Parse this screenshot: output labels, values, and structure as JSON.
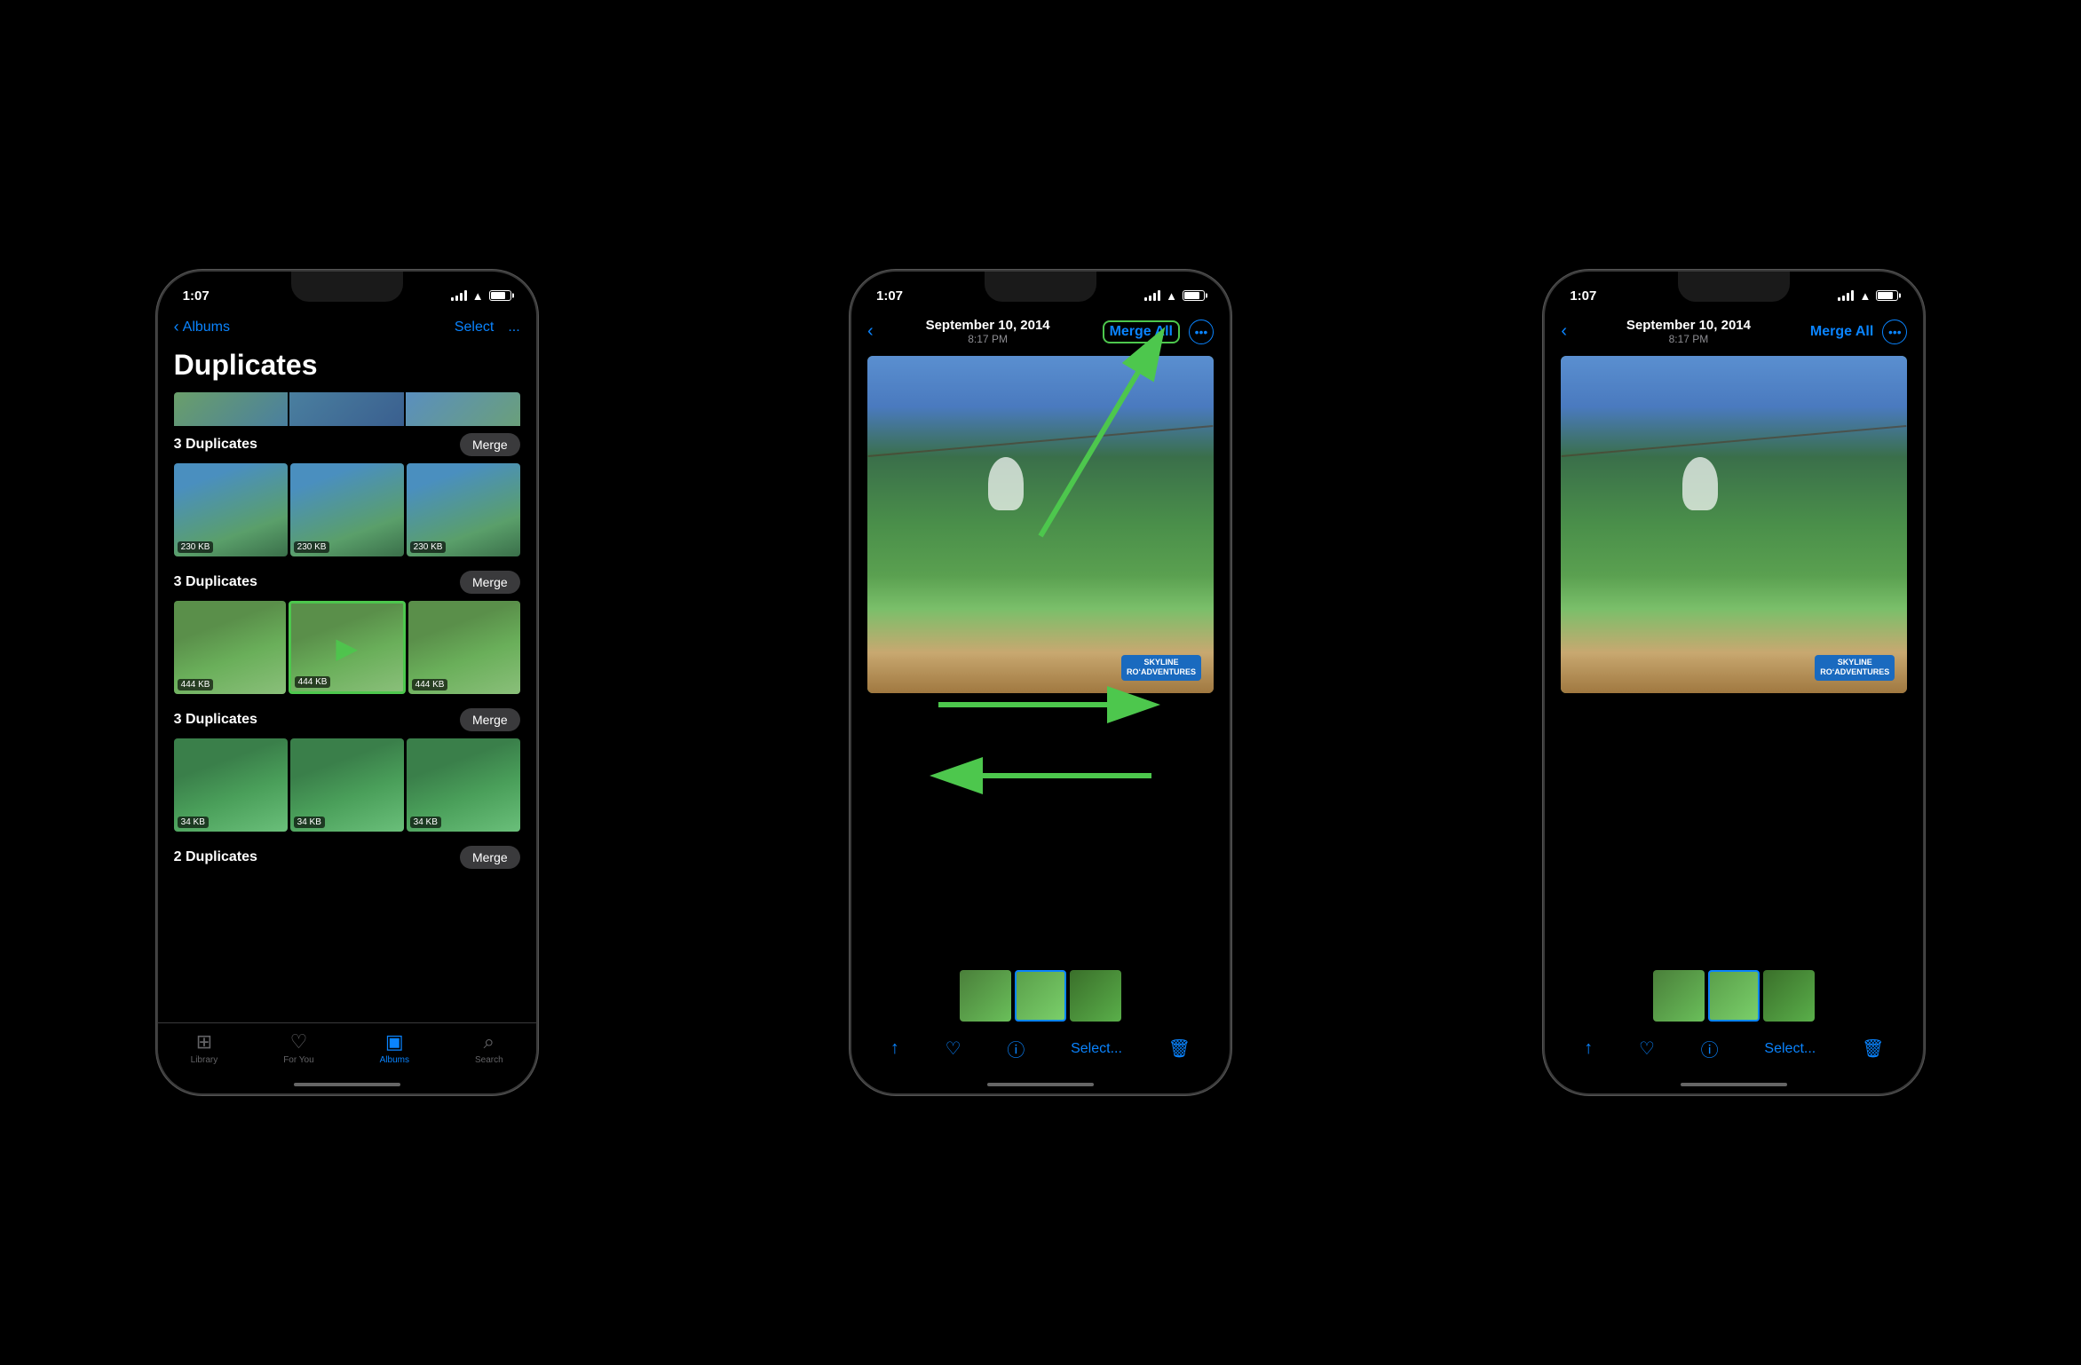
{
  "phone1": {
    "statusBar": {
      "time": "1:07",
      "signal": true,
      "wifi": true,
      "battery": true
    },
    "navBar": {
      "backLabel": "Albums",
      "selectLabel": "Select",
      "moreLabel": "..."
    },
    "title": "Duplicates",
    "groups": [
      {
        "id": "group0",
        "label": "3 Duplicates",
        "mergeLabel": "Merge",
        "photos": [
          {
            "size": "230 KB",
            "bgClass": "bg-group1"
          },
          {
            "size": "230 KB",
            "bgClass": "bg-group1"
          },
          {
            "size": "230 KB",
            "bgClass": "bg-group1"
          }
        ]
      },
      {
        "id": "group1",
        "label": "3 Duplicates",
        "mergeLabel": "Merge",
        "highlighted": true,
        "photos": [
          {
            "size": "444 KB",
            "bgClass": "bg-group2"
          },
          {
            "size": "444 KB",
            "bgClass": "bg-group2",
            "highlighted": true
          },
          {
            "size": "444 KB",
            "bgClass": "bg-group2"
          }
        ]
      },
      {
        "id": "group2",
        "label": "3 Duplicates",
        "mergeLabel": "Merge",
        "photos": [
          {
            "size": "34 KB",
            "bgClass": "bg-group3"
          },
          {
            "size": "34 KB",
            "bgClass": "bg-group3"
          },
          {
            "size": "34 KB",
            "bgClass": "bg-group3"
          }
        ]
      },
      {
        "id": "group3",
        "label": "2 Duplicates",
        "mergeLabel": "Merge",
        "photos": []
      }
    ],
    "tabBar": {
      "items": [
        {
          "label": "Library",
          "icon": "⊞",
          "active": false
        },
        {
          "label": "For You",
          "icon": "♡",
          "active": false
        },
        {
          "label": "Albums",
          "icon": "▣",
          "active": true
        },
        {
          "label": "Search",
          "icon": "⌕",
          "active": false
        }
      ]
    }
  },
  "phone2": {
    "statusBar": {
      "time": "1:07"
    },
    "navBar": {
      "backIcon": "<",
      "date": "September 10, 2014",
      "time": "8:17 PM",
      "mergeAllLabel": "Merge All",
      "mergeAllHighlighted": true,
      "moreIcon": "..."
    },
    "mainPhoto": {
      "skylineBadge": "SKYLINE\nROADVENTURES"
    },
    "thumbnails": [
      {
        "bgClass": "bg-group2"
      },
      {
        "bgClass": "bg-group2"
      },
      {
        "bgClass": "bg-group2"
      }
    ],
    "toolbar": {
      "shareIcon": "↑",
      "heartIcon": "♡",
      "infoIcon": "ⓘ",
      "selectLabel": "Select...",
      "trashIcon": "🗑"
    },
    "arrows": {
      "upArrow": true,
      "rightArrow": true,
      "leftArrow": true
    }
  },
  "phone3": {
    "statusBar": {
      "time": "1:07"
    },
    "navBar": {
      "backIcon": "<",
      "date": "September 10, 2014",
      "time": "8:17 PM",
      "mergeAllLabel": "Merge All",
      "mergeAllHighlighted": false,
      "moreIcon": "..."
    },
    "mainPhoto": {
      "skylineBadge": "SKYLINE\nROADVENTURES"
    },
    "thumbnails": [
      {
        "bgClass": "bg-group2"
      },
      {
        "bgClass": "bg-group2"
      },
      {
        "bgClass": "bg-group2"
      }
    ],
    "toolbar": {
      "shareIcon": "↑",
      "heartIcon": "♡",
      "infoIcon": "ⓘ",
      "selectLabel": "Select...",
      "trashIcon": "🗑"
    }
  }
}
